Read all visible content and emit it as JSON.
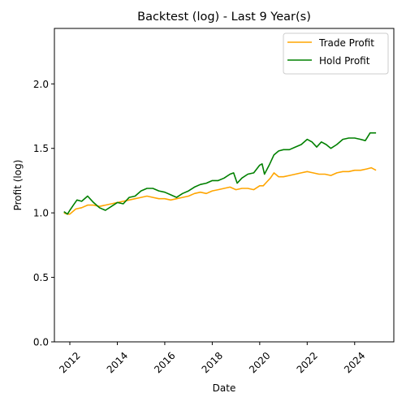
{
  "chart_data": {
    "type": "line",
    "title": "Backtest (log) - Last 9 Year(s)",
    "xlabel": "Date",
    "ylabel": "Profit (log)",
    "xlim": [
      2011.35,
      2025.65
    ],
    "ylim": [
      0.0,
      2.43
    ],
    "xticks": [
      2012,
      2014,
      2016,
      2018,
      2020,
      2022,
      2024
    ],
    "xtick_labels": [
      "2012",
      "2014",
      "2016",
      "2018",
      "2020",
      "2022",
      "2024"
    ],
    "yticks": [
      0.0,
      0.5,
      1.0,
      1.5,
      2.0
    ],
    "ytick_labels": [
      "0.0",
      "0.5",
      "1.0",
      "1.5",
      "2.0"
    ],
    "grid": false,
    "legend_position": "top-right",
    "series": [
      {
        "name": "Trade Profit",
        "color": "#ffa500",
        "x": [
          2011.75,
          2011.9,
          2012.0,
          2012.25,
          2012.5,
          2012.75,
          2013.0,
          2013.25,
          2013.5,
          2013.75,
          2014.0,
          2014.25,
          2014.5,
          2014.75,
          2015.0,
          2015.25,
          2015.5,
          2015.75,
          2016.0,
          2016.25,
          2016.5,
          2016.75,
          2017.0,
          2017.25,
          2017.5,
          2017.75,
          2018.0,
          2018.25,
          2018.5,
          2018.75,
          2019.0,
          2019.25,
          2019.5,
          2019.75,
          2020.0,
          2020.15,
          2020.3,
          2020.45,
          2020.6,
          2020.8,
          2021.0,
          2021.25,
          2021.5,
          2021.75,
          2022.0,
          2022.25,
          2022.5,
          2022.75,
          2023.0,
          2023.25,
          2023.5,
          2023.75,
          2024.0,
          2024.25,
          2024.5,
          2024.7,
          2024.9
        ],
        "values": [
          1.0,
          0.99,
          0.99,
          1.03,
          1.04,
          1.06,
          1.06,
          1.05,
          1.06,
          1.07,
          1.08,
          1.09,
          1.1,
          1.11,
          1.12,
          1.13,
          1.12,
          1.11,
          1.11,
          1.1,
          1.11,
          1.12,
          1.13,
          1.15,
          1.16,
          1.15,
          1.17,
          1.18,
          1.19,
          1.2,
          1.18,
          1.19,
          1.19,
          1.18,
          1.21,
          1.21,
          1.24,
          1.27,
          1.31,
          1.28,
          1.28,
          1.29,
          1.3,
          1.31,
          1.32,
          1.31,
          1.3,
          1.3,
          1.29,
          1.31,
          1.32,
          1.32,
          1.33,
          1.33,
          1.34,
          1.35,
          1.33
        ]
      },
      {
        "name": "Hold Profit",
        "color": "#008000",
        "x": [
          2011.75,
          2011.9,
          2012.0,
          2012.15,
          2012.3,
          2012.5,
          2012.75,
          2013.0,
          2013.25,
          2013.5,
          2013.75,
          2014.0,
          2014.25,
          2014.5,
          2014.75,
          2015.0,
          2015.25,
          2015.5,
          2015.75,
          2016.0,
          2016.25,
          2016.5,
          2016.75,
          2017.0,
          2017.25,
          2017.5,
          2017.75,
          2018.0,
          2018.25,
          2018.5,
          2018.75,
          2018.9,
          2019.05,
          2019.25,
          2019.5,
          2019.75,
          2020.0,
          2020.1,
          2020.2,
          2020.4,
          2020.6,
          2020.8,
          2021.0,
          2021.25,
          2021.5,
          2021.75,
          2022.0,
          2022.2,
          2022.4,
          2022.6,
          2022.8,
          2023.0,
          2023.25,
          2023.5,
          2023.75,
          2024.0,
          2024.25,
          2024.45,
          2024.65,
          2024.9
        ],
        "values": [
          1.01,
          0.99,
          1.02,
          1.06,
          1.1,
          1.09,
          1.13,
          1.08,
          1.04,
          1.02,
          1.05,
          1.08,
          1.07,
          1.12,
          1.13,
          1.17,
          1.19,
          1.19,
          1.17,
          1.16,
          1.14,
          1.12,
          1.15,
          1.17,
          1.2,
          1.22,
          1.23,
          1.25,
          1.25,
          1.27,
          1.3,
          1.31,
          1.23,
          1.27,
          1.3,
          1.31,
          1.37,
          1.38,
          1.3,
          1.37,
          1.45,
          1.48,
          1.49,
          1.49,
          1.51,
          1.53,
          1.57,
          1.55,
          1.51,
          1.55,
          1.53,
          1.5,
          1.53,
          1.57,
          1.58,
          1.58,
          1.57,
          1.56,
          1.62,
          1.62
        ]
      }
    ]
  }
}
